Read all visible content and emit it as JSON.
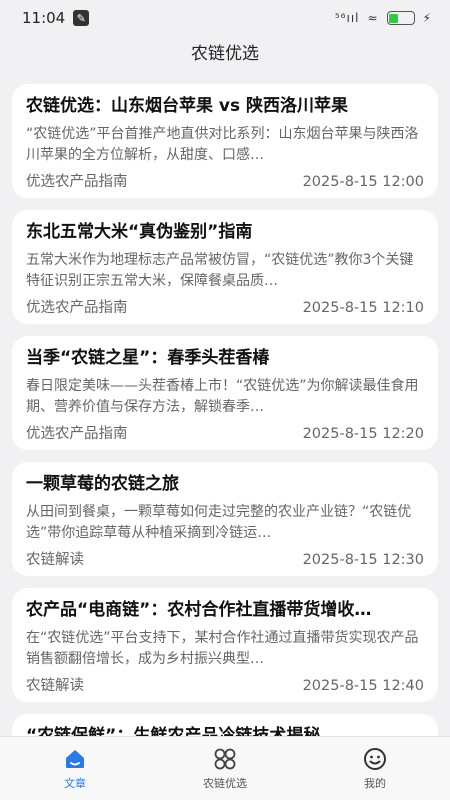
{
  "status": {
    "time": "11:04",
    "signal": "⁵⁶ııl",
    "wifi": "≈"
  },
  "page_title": "农链优选",
  "articles": [
    {
      "title": "农链优选：山东烟台苹果 vs 陕西洛川苹果",
      "summary": "“农链优选”平台首推产地直供对比系列：山东烟台苹果与陕西洛川苹果的全方位解析，从甜度、口感…",
      "category": "优选农产品指南",
      "date": "2025-8-15 12:00"
    },
    {
      "title": "东北五常大米“真伪鉴别”指南",
      "summary": "五常大米作为地理标志产品常被仿冒，“农链优选”教你3个关键特征识别正宗五常大米，保障餐桌品质…",
      "category": "优选农产品指南",
      "date": "2025-8-15 12:10"
    },
    {
      "title": "当季“农链之星”：春季头茬香椿",
      "summary": "春日限定美味——头茬香椿上市！“农链优选”为你解读最佳食用期、营养价值与保存方法，解锁春季…",
      "category": "优选农产品指南",
      "date": "2025-8-15 12:20"
    },
    {
      "title": "一颗草莓的农链之旅",
      "summary": "从田间到餐桌，一颗草莓如何走过完整的农业产业链？“农链优选”带你追踪草莓从种植采摘到冷链运…",
      "category": "农链解读",
      "date": "2025-8-15 12:30"
    },
    {
      "title": "农产品“电商链”：农村合作社直播带货增收…",
      "summary": "在“农链优选”平台支持下，某村合作社通过直播带货实现农产品销售额翻倍增长，成为乡村振兴典型…",
      "category": "农链解读",
      "date": "2025-8-15 12:40"
    },
    {
      "title": "“农链保鲜”：生鲜农产品冷链技术揭秘",
      "summary": "",
      "category": "",
      "date": ""
    }
  ],
  "tabs": [
    {
      "label": "文章",
      "icon": "home-icon",
      "active": true
    },
    {
      "label": "农链优选",
      "icon": "grid-flower-icon",
      "active": false
    },
    {
      "label": "我的",
      "icon": "smiley-icon",
      "active": false
    }
  ],
  "colors": {
    "accent": "#2a7ae8",
    "background": "#f1f1f3",
    "card": "#ffffff",
    "battery": "#2ecc40"
  }
}
